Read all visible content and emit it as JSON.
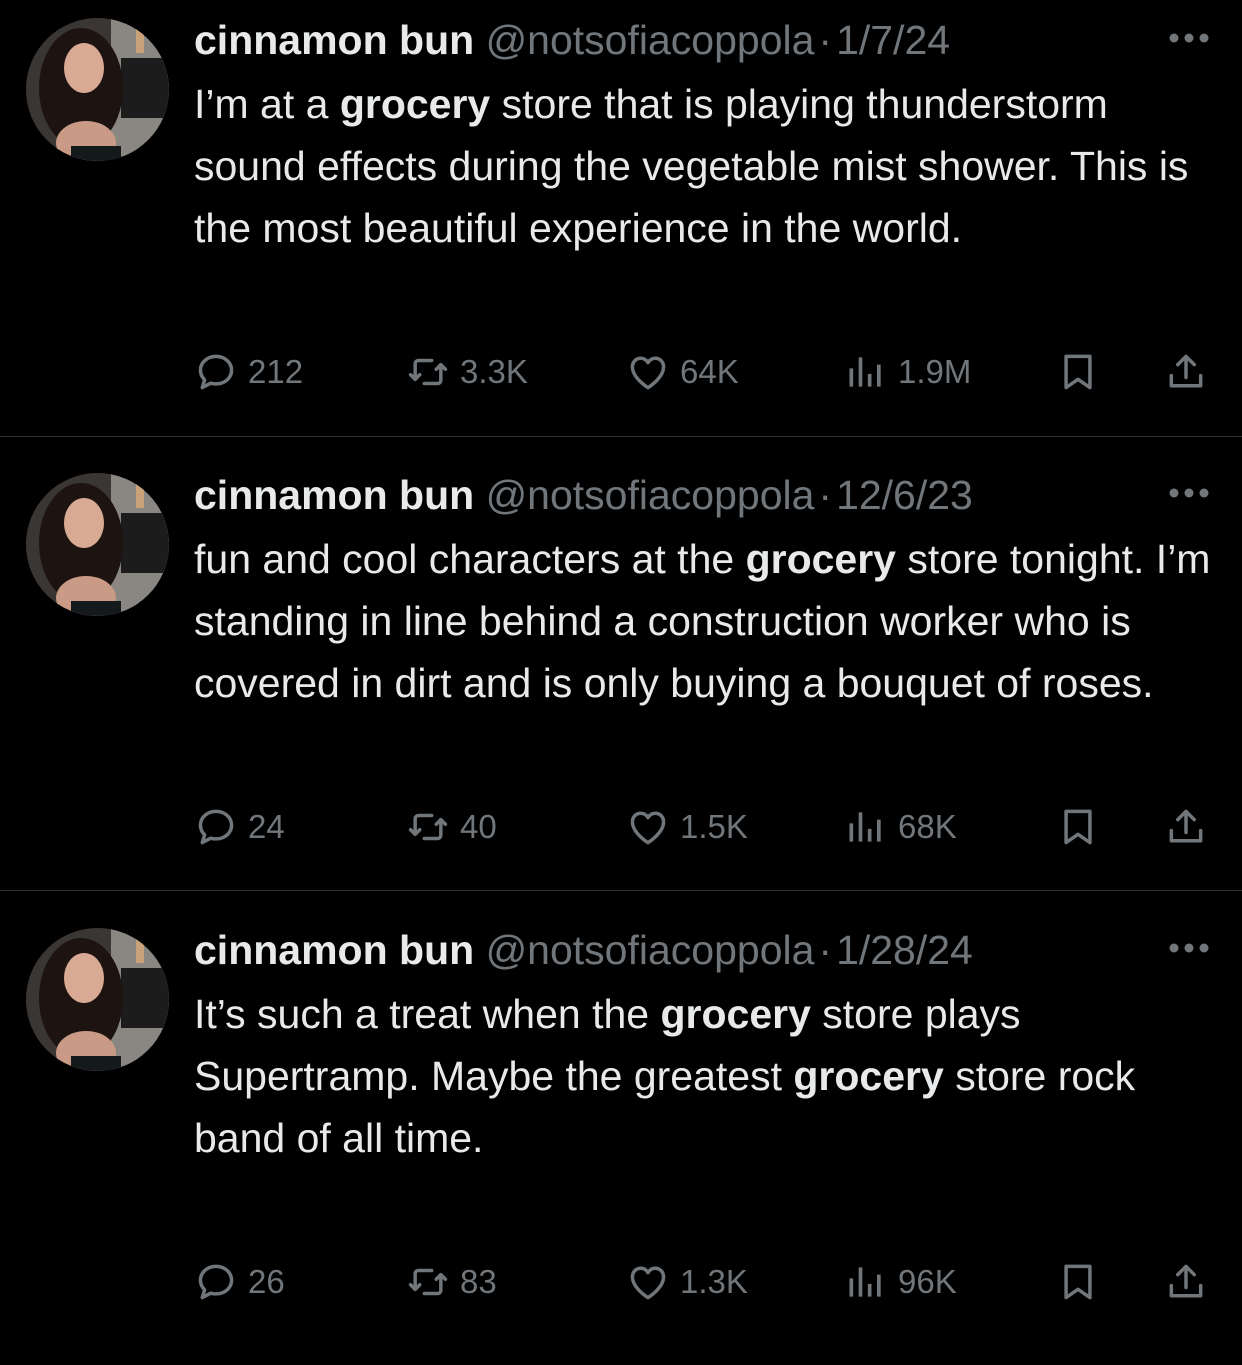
{
  "tweets": [
    {
      "name": "cinnamon bun",
      "handle": "@notsofiacoppola",
      "separator": "·",
      "date": "1/7/24",
      "text_parts": [
        {
          "t": "I’m at a "
        },
        {
          "t": "grocery",
          "bold": true
        },
        {
          "t": " store that is playing thunderstorm sound effects during the vegetable mist shower. This is the most beautiful experience in the world."
        }
      ],
      "replies": "212",
      "retweets": "3.3K",
      "likes": "64K",
      "views": "1.9M"
    },
    {
      "name": "cinnamon bun",
      "handle": "@notsofiacoppola",
      "separator": "·",
      "date": "12/6/23",
      "text_parts": [
        {
          "t": "fun and cool characters at the "
        },
        {
          "t": "grocery",
          "bold": true
        },
        {
          "t": " store tonight. I’m standing in line behind a construction worker who is covered in dirt and is only buying a bouquet of roses."
        }
      ],
      "replies": "24",
      "retweets": "40",
      "likes": "1.5K",
      "views": "68K"
    },
    {
      "name": "cinnamon bun",
      "handle": "@notsofiacoppola",
      "separator": "·",
      "date": "1/28/24",
      "text_parts": [
        {
          "t": "It’s such a treat when the "
        },
        {
          "t": "grocery",
          "bold": true
        },
        {
          "t": " store plays Supertramp. Maybe the greatest "
        },
        {
          "t": "grocery",
          "bold": true
        },
        {
          "t": " store rock band of all time."
        }
      ],
      "replies": "26",
      "retweets": "83",
      "likes": "1.3K",
      "views": "96K"
    }
  ],
  "icons": {
    "more": "more-dots-icon",
    "reply": "reply-bubble-icon",
    "retweet": "retweet-arrows-icon",
    "like": "heart-icon",
    "views": "views-bars-icon",
    "bookmark": "bookmark-icon",
    "share": "share-upload-icon"
  },
  "colors": {
    "background": "#000000",
    "primary_text": "#e7e9ea",
    "secondary_text": "#71767b",
    "divider": "#2f3336"
  }
}
